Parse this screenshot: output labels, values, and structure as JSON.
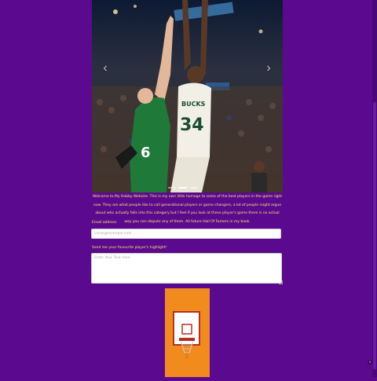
{
  "carousel": {
    "prev_label": "‹",
    "next_label": "›",
    "slide_count": 3,
    "active_index": 1,
    "jersey_left": "6",
    "jersey_right": "34",
    "jersey_right_team": "BUCKS"
  },
  "intro": {
    "text": "Welcome to My Hobby Website. This is my own little homage to some of the best players in the game right now. They are what people like to call generational players or game changers, a lot of people might argue about who actually falls into this category but I feel if you look at these player's game there is no actual way you can dispute any of them. All future Hall Of Famers in my book."
  },
  "form": {
    "email_label": "Email address",
    "email_placeholder": "Email@example.com",
    "highlight_label": "Send me your favourite player's highlight!",
    "highlight_placeholder": "Enter Your Text Here"
  },
  "colors": {
    "page_background": "#5b0a8f",
    "accent_text": "#f4e36b",
    "card_orange": "#f28b1e",
    "hoop_red": "#c0392b"
  },
  "icons": {
    "hoop": "basketball-hoop-icon",
    "badge": "settings-badge-icon"
  },
  "badge": {
    "label": "0"
  }
}
